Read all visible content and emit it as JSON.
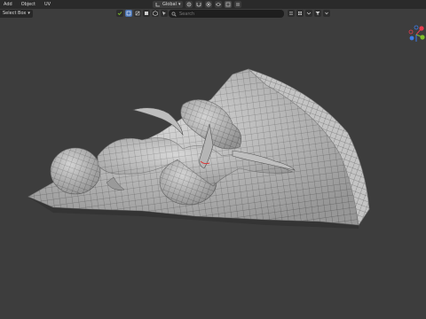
{
  "header": {
    "menu": [
      "Add",
      "Object",
      "UV"
    ],
    "transform_orientation": "Global"
  },
  "toolbar": {
    "select_mode": "Select Box",
    "search_placeholder": "Search"
  },
  "colors": {
    "viewport_bg": "#3d3d3d",
    "header_bg": "#2a2a2a",
    "active_blue": "#4772b3",
    "gizmo_x": "#e53b4c",
    "gizmo_y": "#7fbf2a",
    "gizmo_z": "#3d7ce8"
  },
  "icons": [
    "pivot-icon",
    "snap-icon",
    "proportional-icon",
    "filter-icon",
    "eye-icon",
    "restrict-select-icon",
    "search-icon",
    "navigation-gizmo"
  ]
}
